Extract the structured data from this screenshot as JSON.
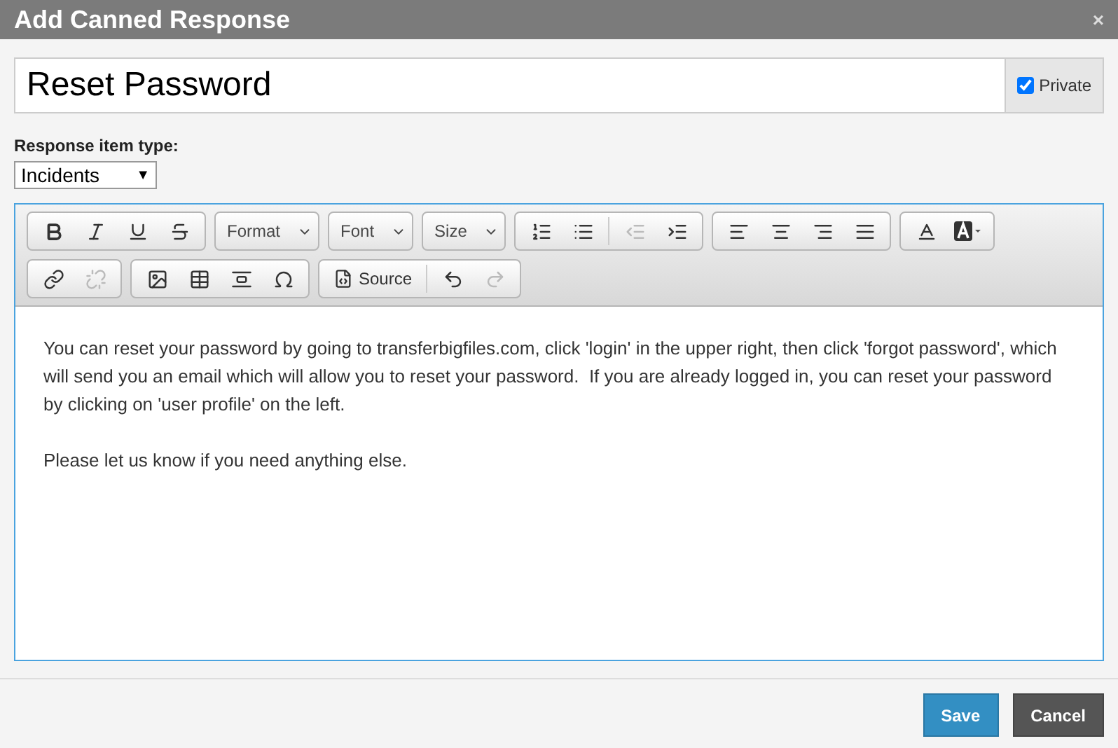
{
  "window": {
    "title": "Add Canned Response",
    "close": "×"
  },
  "subject": {
    "value": "Reset Password"
  },
  "private": {
    "label": "Private",
    "checked": true
  },
  "type_field": {
    "label": "Response item type:",
    "value": "Incidents",
    "arrow": "▼"
  },
  "toolbar": [
    [
      {
        "kind": "group",
        "buttons": [
          {
            "kind": "bold",
            "disabled": false
          },
          {
            "kind": "italic",
            "disabled": false
          },
          {
            "kind": "underline",
            "disabled": false
          },
          {
            "kind": "strike",
            "disabled": false
          }
        ]
      },
      {
        "kind": "dropdown",
        "label": "Format"
      },
      {
        "kind": "dropdown",
        "label": "Font"
      },
      {
        "kind": "dropdown",
        "label": "Size"
      },
      {
        "kind": "group",
        "buttons": [
          {
            "kind": "ordered-list",
            "disabled": false
          },
          {
            "kind": "bullet-list",
            "disabled": false
          },
          {
            "kind": "separator"
          },
          {
            "kind": "outdent",
            "disabled": true
          },
          {
            "kind": "indent",
            "disabled": false
          }
        ]
      },
      {
        "kind": "group",
        "buttons": [
          {
            "kind": "align-left",
            "disabled": false
          },
          {
            "kind": "align-center",
            "disabled": false
          },
          {
            "kind": "align-right",
            "disabled": false
          },
          {
            "kind": "justify",
            "disabled": false
          }
        ]
      },
      {
        "kind": "group",
        "buttons": [
          {
            "kind": "text-color",
            "disabled": false
          },
          {
            "kind": "bg-color",
            "disabled": false
          }
        ]
      }
    ],
    [
      {
        "kind": "group",
        "buttons": [
          {
            "kind": "link",
            "disabled": false
          },
          {
            "kind": "unlink",
            "disabled": true
          }
        ]
      },
      {
        "kind": "group",
        "buttons": [
          {
            "kind": "image",
            "disabled": false
          },
          {
            "kind": "table",
            "disabled": false
          },
          {
            "kind": "rule",
            "disabled": false
          },
          {
            "kind": "omega",
            "disabled": false
          }
        ]
      },
      {
        "kind": "group",
        "buttons": [
          {
            "kind": "source",
            "label": "Source",
            "disabled": false
          },
          {
            "kind": "separator"
          },
          {
            "kind": "undo",
            "disabled": false
          },
          {
            "kind": "redo",
            "disabled": true
          }
        ]
      }
    ]
  ],
  "body": [
    "You can reset your password by going to transferbigfiles.com, click 'login' in the upper right, then click 'forgot password', which will send you an email which will allow you to reset your password.  If you are already logged in, you can reset your password by clicking on 'user profile' on the left.",
    "Please let us know if you need anything else."
  ],
  "buttons": [
    {
      "kind": "primary",
      "label": "Save"
    },
    {
      "kind": "secondary",
      "label": "Cancel"
    }
  ]
}
